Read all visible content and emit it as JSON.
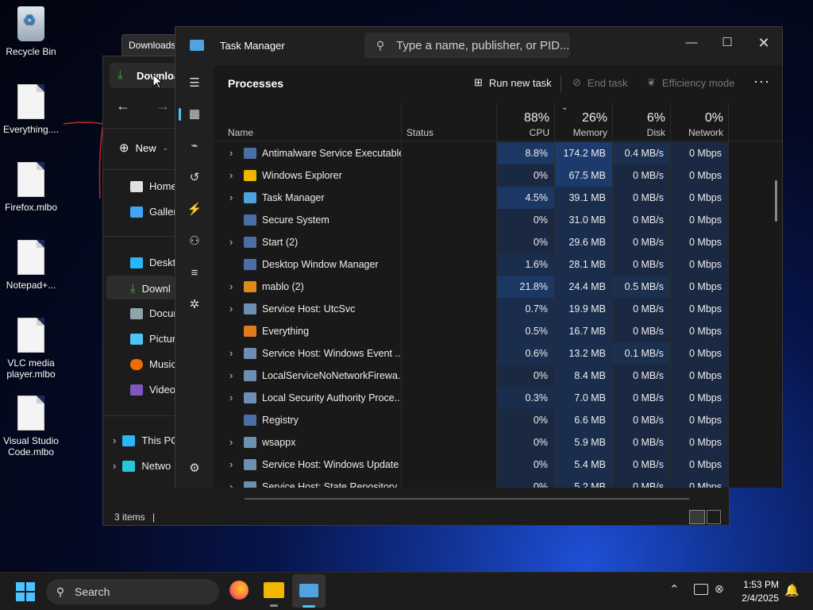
{
  "desktop": {
    "icons": [
      {
        "label": "Recycle Bin"
      },
      {
        "label": "Everything...."
      },
      {
        "label": "Firefox.mlbo"
      },
      {
        "label": "Notepad+..."
      },
      {
        "label": "VLC media player.mlbo"
      },
      {
        "label": "Visual Studio Code.mlbo"
      }
    ]
  },
  "explorer": {
    "tab_tooltip": "Downloads",
    "tab_title": "Downloa",
    "new_label": "New",
    "nav": [
      "Home",
      "Gallery",
      "Deskto",
      "Downl",
      "Docum",
      "Picture",
      "Music",
      "Videos",
      "This PC",
      "Netwo"
    ],
    "status": "3 items"
  },
  "taskmanager": {
    "title": "Task Manager",
    "search_placeholder": "Type a name, publisher, or PID...",
    "page_title": "Processes",
    "run_new_task": "Run new task",
    "end_task": "End task",
    "efficiency_mode": "Efficiency mode",
    "columns": {
      "name": "Name",
      "status": "Status",
      "cpu_pct": "88%",
      "cpu": "CPU",
      "mem_pct": "26%",
      "mem": "Memory",
      "disk_pct": "6%",
      "disk": "Disk",
      "net_pct": "0%",
      "net": "Network"
    },
    "processes": [
      {
        "name": "Antimalware Service Executable",
        "cpu": "8.8%",
        "mem": "174.2 MB",
        "disk": "0.4 MB/s",
        "net": "0 Mbps"
      },
      {
        "name": "Windows Explorer",
        "cpu": "0%",
        "mem": "67.5 MB",
        "disk": "0 MB/s",
        "net": "0 Mbps"
      },
      {
        "name": "Task Manager",
        "cpu": "4.5%",
        "mem": "39.1 MB",
        "disk": "0 MB/s",
        "net": "0 Mbps"
      },
      {
        "name": "Secure System",
        "cpu": "0%",
        "mem": "31.0 MB",
        "disk": "0 MB/s",
        "net": "0 Mbps"
      },
      {
        "name": "Start (2)",
        "cpu": "0%",
        "mem": "29.6 MB",
        "disk": "0 MB/s",
        "net": "0 Mbps"
      },
      {
        "name": "Desktop Window Manager",
        "cpu": "1.6%",
        "mem": "28.1 MB",
        "disk": "0 MB/s",
        "net": "0 Mbps"
      },
      {
        "name": "mablo (2)",
        "cpu": "21.8%",
        "mem": "24.4 MB",
        "disk": "0.5 MB/s",
        "net": "0 Mbps"
      },
      {
        "name": "Service Host: UtcSvc",
        "cpu": "0.7%",
        "mem": "19.9 MB",
        "disk": "0 MB/s",
        "net": "0 Mbps"
      },
      {
        "name": "Everything",
        "cpu": "0.5%",
        "mem": "16.7 MB",
        "disk": "0 MB/s",
        "net": "0 Mbps"
      },
      {
        "name": "Service Host: Windows Event ...",
        "cpu": "0.6%",
        "mem": "13.2 MB",
        "disk": "0.1 MB/s",
        "net": "0 Mbps"
      },
      {
        "name": "LocalServiceNoNetworkFirewa...",
        "cpu": "0%",
        "mem": "8.4 MB",
        "disk": "0 MB/s",
        "net": "0 Mbps"
      },
      {
        "name": "Local Security Authority Proce...",
        "cpu": "0.3%",
        "mem": "7.0 MB",
        "disk": "0 MB/s",
        "net": "0 Mbps"
      },
      {
        "name": "Registry",
        "cpu": "0%",
        "mem": "6.6 MB",
        "disk": "0 MB/s",
        "net": "0 Mbps"
      },
      {
        "name": "wsappx",
        "cpu": "0%",
        "mem": "5.9 MB",
        "disk": "0 MB/s",
        "net": "0 Mbps"
      },
      {
        "name": "Service Host: Windows Update",
        "cpu": "0%",
        "mem": "5.4 MB",
        "disk": "0 MB/s",
        "net": "0 Mbps"
      },
      {
        "name": "Service Host: State Repository ...",
        "cpu": "0%",
        "mem": "5.2 MB",
        "disk": "0 MB/s",
        "net": "0 Mbps"
      }
    ]
  },
  "taskbar": {
    "search_label": "Search",
    "time": "1:53 PM",
    "date": "2/4/2025"
  }
}
